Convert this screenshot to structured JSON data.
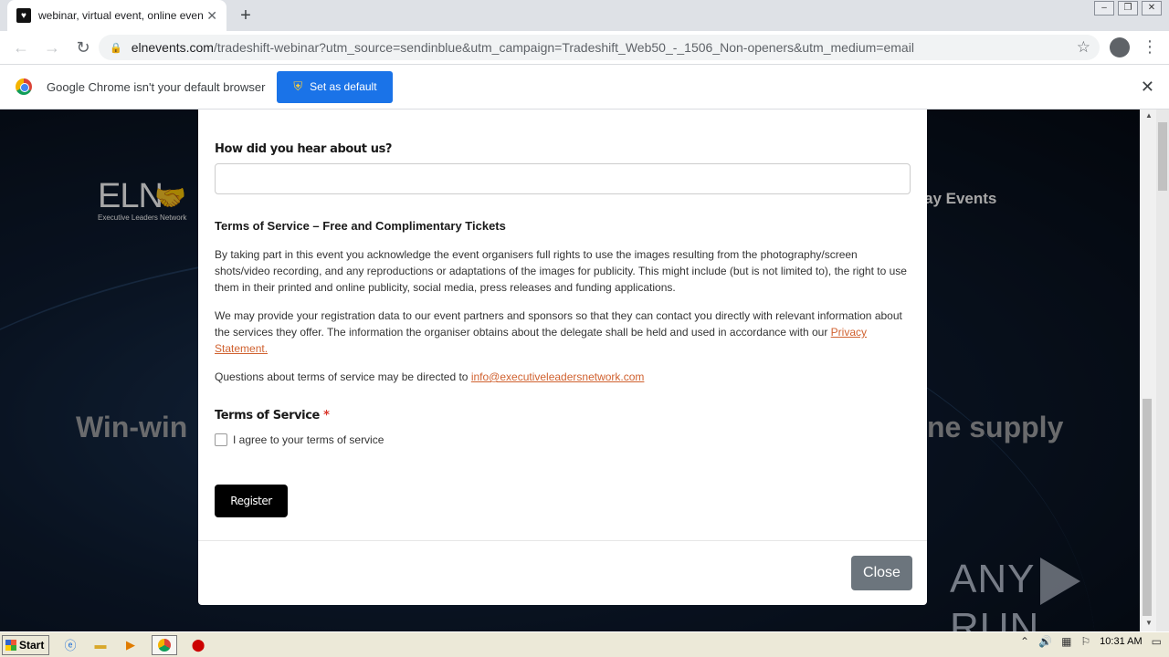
{
  "browser": {
    "tab_title": "webinar, virtual event, online event,",
    "url_host": "elnevents.com",
    "url_path": "/tradeshift-webinar?utm_source=sendinblue&utm_campaign=Tradeshift_Web50_-_1506_Non-openers&utm_medium=email",
    "infobar_text": "Google Chrome isn't your default browser",
    "set_default_label": "Set as default"
  },
  "background": {
    "logo_text": "ELN",
    "logo_subtext": "Executive Leaders Network",
    "nav_fragment": "ay Events",
    "hero_left": "Win-win",
    "hero_right": "ne supply",
    "watermark": "ANY",
    "watermark2": "RUN"
  },
  "modal": {
    "hear_label": "How did you hear about us?",
    "tos_heading": "Terms of Service – Free and Complimentary Tickets",
    "para1": "By taking part in this event you acknowledge the event organisers full rights to use the images resulting from the photography/screen shots/video recording, and any reproductions or adaptations of the images for publicity. This might include (but is not limited to), the right to use them in their printed and online publicity, social media, press releases and funding applications.",
    "para2": "We may provide your registration data to our event partners and sponsors so that they can contact you directly with relevant information about the services they offer. The information the organiser obtains about the delegate shall be held and used in accordance with our ",
    "privacy_link": "Privacy Statement.",
    "para3": "Questions about terms of service may be directed to ",
    "email_link": "info@executiveleadersnetwork.com",
    "tos_label": "Terms of Service",
    "required_mark": "*",
    "agree_label": "I agree to your terms of service",
    "register_label": "Register",
    "close_label": "Close"
  },
  "taskbar": {
    "start_label": "Start",
    "clock": "10:31 AM"
  },
  "colors": {
    "accent_blue": "#1a73e8",
    "link_orange": "#d0612f",
    "close_gray": "#6c757d"
  }
}
